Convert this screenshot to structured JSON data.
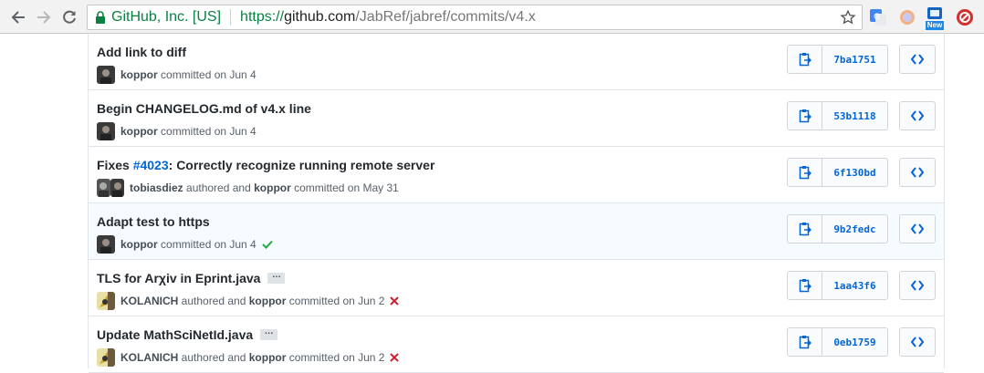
{
  "browser": {
    "secure_label": "GitHub, Inc. [US]",
    "url": {
      "scheme": "https://",
      "host": "github.com",
      "path": "/JabRef/jabref/commits/v4.x"
    },
    "extensions": [
      "google-translate-icon",
      "circle-extension-icon",
      "new-badge-icon",
      "adblock-icon"
    ],
    "new_badge_label": "New"
  },
  "commits": [
    {
      "title_parts": [
        "Add link to diff"
      ],
      "issue": null,
      "has_ellipsis": false,
      "author": "",
      "committer": "koppor",
      "date_text": "committed on Jun 4",
      "status": "none",
      "sha": "7ba1751"
    },
    {
      "title_parts": [
        "Begin CHANGELOG.md of v4.x line"
      ],
      "issue": null,
      "has_ellipsis": false,
      "author": "",
      "committer": "koppor",
      "date_text": "committed on Jun 4",
      "status": "none",
      "sha": "53b1118"
    },
    {
      "title_prefix": "Fixes ",
      "issue": "#4023",
      "title_suffix": ": Correctly recognize running remote server",
      "has_ellipsis": false,
      "author": "tobiasdiez",
      "authored_text": "authored and",
      "committer": "koppor",
      "date_text": "committed on May 31",
      "status": "none",
      "sha": "6f130bd"
    },
    {
      "title_parts": [
        "Adapt test to https"
      ],
      "issue": null,
      "has_ellipsis": false,
      "author": "",
      "committer": "koppor",
      "date_text": "committed on Jun 4",
      "status": "success",
      "sha": "9b2fedc"
    },
    {
      "title_parts": [
        "TLS for Arχiv in Eprint.java"
      ],
      "issue": null,
      "has_ellipsis": true,
      "author": "KOLANICH",
      "authored_text": "authored and",
      "committer": "koppor",
      "date_text": "committed on Jun 2",
      "status": "failure",
      "sha": "1aa43f6"
    },
    {
      "title_parts": [
        "Update MathSciNetId.java"
      ],
      "issue": null,
      "has_ellipsis": true,
      "author": "KOLANICH",
      "authored_text": "authored and",
      "committer": "koppor",
      "date_text": "committed on Jun 2",
      "status": "failure",
      "sha": "0eb1759"
    }
  ],
  "ellipsis_label": "…",
  "colors": {
    "link": "#0366d6",
    "success": "#28a745",
    "failure": "#cb2431",
    "secure": "#0b8043"
  }
}
